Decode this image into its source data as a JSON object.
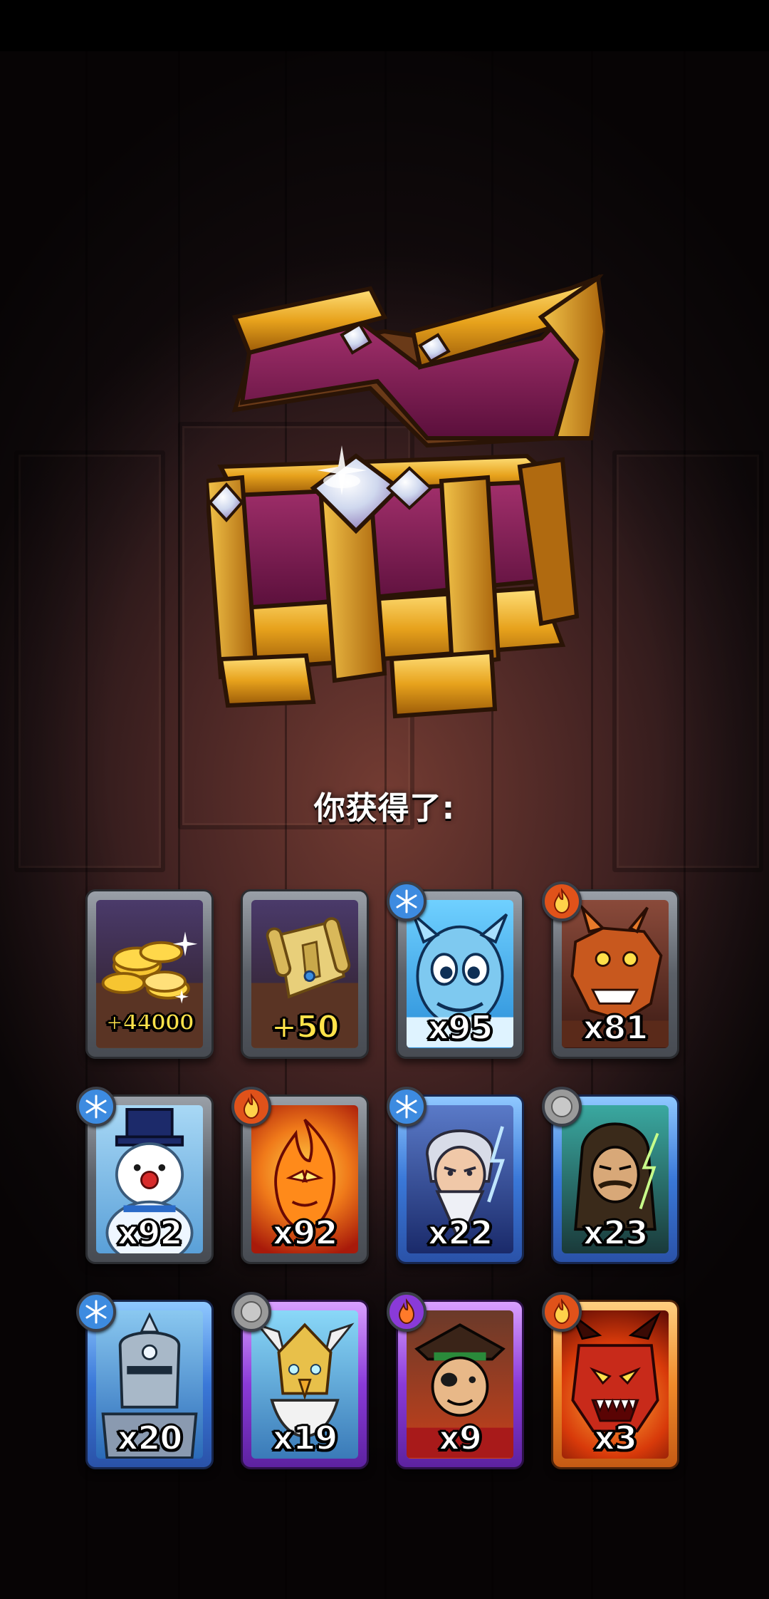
{
  "heading": "你获得了:",
  "rewards": [
    {
      "label": "+44000",
      "icon": "coins-icon",
      "frame": "grey",
      "element": null
    },
    {
      "label": "+50",
      "icon": "scroll-icon",
      "frame": "grey",
      "element": null
    },
    {
      "label": "x95",
      "icon": "ice-dragon-hero",
      "frame": "grey",
      "element": "ice"
    },
    {
      "label": "x81",
      "icon": "fire-dragon-hero",
      "frame": "grey",
      "element": "fire"
    },
    {
      "label": "x92",
      "icon": "snowman-hero",
      "frame": "grey",
      "element": "ice"
    },
    {
      "label": "x92",
      "icon": "fire-elemental-hero",
      "frame": "grey",
      "element": "fire"
    },
    {
      "label": "x22",
      "icon": "storm-wizard-hero",
      "frame": "blue",
      "element": "ice"
    },
    {
      "label": "x23",
      "icon": "hooded-rogue-hero",
      "frame": "blue",
      "element": "neutral"
    },
    {
      "label": "x20",
      "icon": "ice-knight-hero",
      "frame": "blue",
      "element": "ice"
    },
    {
      "label": "x19",
      "icon": "eagle-warrior-hero",
      "frame": "purple",
      "element": "neutral"
    },
    {
      "label": "x9",
      "icon": "pirate-hero",
      "frame": "purple",
      "element": "fire"
    },
    {
      "label": "x3",
      "icon": "demon-beast-hero",
      "frame": "orange",
      "element": "fire"
    }
  ],
  "colors": {
    "gold_text": "#ffe34a",
    "frame_grey": "#5b6068",
    "frame_blue": "#3a78d8",
    "frame_purple": "#8a3ad8",
    "frame_orange": "#f08a2a",
    "ice_badge": "#3d8be0",
    "fire_badge": "#e0521a",
    "neutral_badge": "#9a9a9a"
  }
}
